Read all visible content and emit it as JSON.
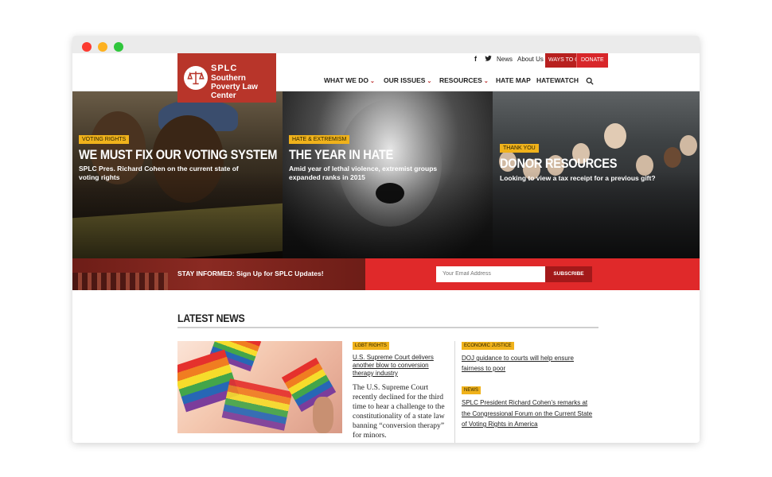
{
  "topbar": {
    "news_label": "News",
    "about_label": "About Us",
    "give_label": "WAYS TO GIVE",
    "donate_label": "DONATE",
    "facebook_icon": "facebook-icon",
    "twitter_icon": "twitter-icon"
  },
  "logo": {
    "line1": "SPLC",
    "line2": "Southern Poverty Law Center",
    "icon": "scales-icon",
    "color": "#b8352a"
  },
  "nav": {
    "items": [
      {
        "label": "WHAT WE DO",
        "has_dropdown": true
      },
      {
        "label": "OUR ISSUES",
        "has_dropdown": true
      },
      {
        "label": "RESOURCES",
        "has_dropdown": true
      },
      {
        "label": "HATE MAP",
        "has_dropdown": false
      },
      {
        "label": "HATEWATCH",
        "has_dropdown": false
      }
    ],
    "search_icon": "search-icon"
  },
  "hero": {
    "panels": [
      {
        "tag": "VOTING RIGHTS",
        "headline": "WE MUST FIX OUR VOTING SYSTEM",
        "subtext": "SPLC Pres. Richard Cohen on the current state of voting rights"
      },
      {
        "tag": "HATE & EXTREMISM",
        "headline": "THE YEAR IN HATE",
        "subtext": "Amid year of lethal violence, extremist groups expanded ranks in 2015"
      },
      {
        "tag": "THANK YOU",
        "headline": "DONOR RESOURCES",
        "subtext": "Looking to view a tax receipt for a previous gift?"
      }
    ]
  },
  "signup": {
    "text": "STAY INFORMED: Sign Up for SPLC Updates!",
    "placeholder": "Your Email Address",
    "button": "SUBSCRIBE"
  },
  "latest": {
    "heading": "LATEST NEWS",
    "articles": [
      {
        "tag": "LGBT RIGHTS",
        "title": "U.S. Supreme Court delivers another blow to conversion therapy industry",
        "body": "The U.S. Supreme Court recently declined for the third time to hear a challenge to the constitutionality of a state law banning “conversion therapy” for minors."
      },
      {
        "tag": "ECONOMIC JUSTICE",
        "title": "DOJ guidance to courts will help ensure fairness to poor"
      },
      {
        "tag": "NEWS",
        "title": "SPLC President Richard Cohen’s remarks at the Congressional Forum on the Current State of Voting Rights in America"
      }
    ]
  },
  "colors": {
    "brand_red": "#e0292a",
    "tag_yellow": "#f0b21b",
    "dark_red": "#a3191a"
  }
}
